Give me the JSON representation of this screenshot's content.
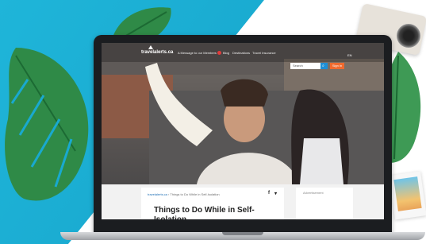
{
  "site": {
    "logo": "travelalerts.ca",
    "nav": [
      "A Message to our Members",
      "Blog",
      "Destinations",
      "Travel Insurance"
    ],
    "language": "EN",
    "search_placeholder": "Search",
    "search_icon": "search-icon",
    "signin_label": "Sign in"
  },
  "article": {
    "breadcrumb_link": "travelalerts.ca",
    "breadcrumb_current": "Things to Do While in Self-Isolation",
    "share_icons": [
      "facebook-icon",
      "twitter-icon"
    ],
    "title": "Things to Do While in Self-Isolation"
  },
  "sidebar": {
    "ad_label": "Advertisement"
  },
  "colors": {
    "teal_bg": "#1fb5d9",
    "search_button": "#1e8fd6",
    "signin_button": "#ef6a2f"
  }
}
